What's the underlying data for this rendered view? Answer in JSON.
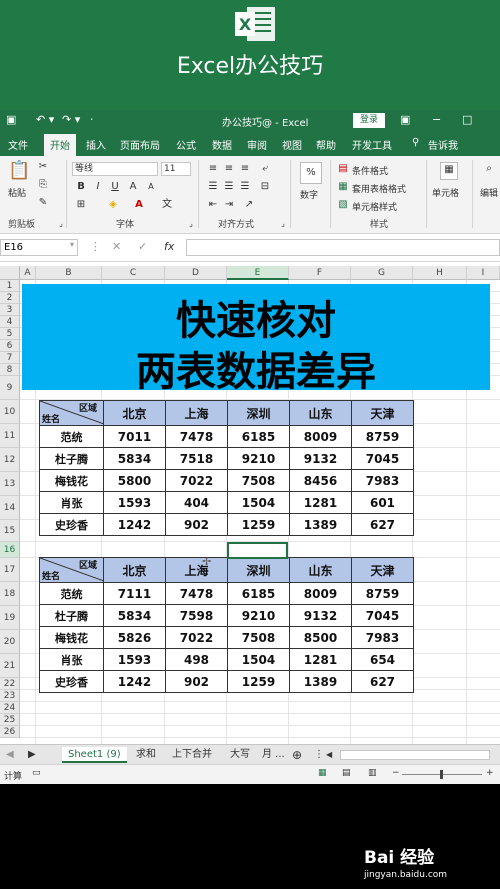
{
  "banner": {
    "title": "Excel办公技巧",
    "logo_letter": "X"
  },
  "titlebar": {
    "document": "办公技巧@ - Excel",
    "login": "登录"
  },
  "ribbon_tabs": [
    "文件",
    "开始",
    "插入",
    "页面布局",
    "公式",
    "数据",
    "审阅",
    "视图",
    "帮助",
    "开发工具",
    "告诉我"
  ],
  "ribbon": {
    "paste": "粘贴",
    "font_name": "等线",
    "font_size": "11",
    "bold": "B",
    "italic": "I",
    "underline": "U",
    "number": "数字",
    "percent": "%",
    "cond_format": "条件格式",
    "table_format": "套用表格格式",
    "cell_style": "单元格样式",
    "cells": "单元格",
    "edit": "编辑",
    "groups": [
      "剪贴板",
      "字体",
      "对齐方式",
      "样式"
    ]
  },
  "formula_bar": {
    "name_box": "E16",
    "fx": "fx"
  },
  "columns": [
    "A",
    "B",
    "C",
    "D",
    "E",
    "F",
    "G",
    "H",
    "I"
  ],
  "rows": [
    "1",
    "2",
    "3",
    "4",
    "5",
    "6",
    "7",
    "8",
    "9",
    "10",
    "11",
    "12",
    "13",
    "14",
    "15",
    "16",
    "17",
    "18",
    "19",
    "20",
    "21",
    "22",
    "23",
    "24",
    "25",
    "26"
  ],
  "hero": {
    "line1": "快速核对",
    "line2": "两表数据差异"
  },
  "table_corner": {
    "top": "区域",
    "bottom": "姓名"
  },
  "table_headers": [
    "北京",
    "上海",
    "深圳",
    "山东",
    "天津"
  ],
  "table1": [
    {
      "name": "范统",
      "values": [
        "7011",
        "7478",
        "6185",
        "8009",
        "8759"
      ]
    },
    {
      "name": "杜子腾",
      "values": [
        "5834",
        "7518",
        "9210",
        "9132",
        "7045"
      ]
    },
    {
      "name": "梅钱花",
      "values": [
        "5800",
        "7022",
        "7508",
        "8456",
        "7983"
      ]
    },
    {
      "name": "肖张",
      "values": [
        "1593",
        "404",
        "1504",
        "1281",
        "601"
      ]
    },
    {
      "name": "史珍香",
      "values": [
        "1242",
        "902",
        "1259",
        "1389",
        "627"
      ]
    }
  ],
  "table2": [
    {
      "name": "范统",
      "values": [
        "7111",
        "7478",
        "6185",
        "8009",
        "8759"
      ]
    },
    {
      "name": "杜子腾",
      "values": [
        "5834",
        "7598",
        "9210",
        "9132",
        "7045"
      ]
    },
    {
      "name": "梅钱花",
      "values": [
        "5826",
        "7022",
        "7508",
        "8500",
        "7983"
      ]
    },
    {
      "name": "肖张",
      "values": [
        "1593",
        "498",
        "1504",
        "1281",
        "654"
      ]
    },
    {
      "name": "史珍香",
      "values": [
        "1242",
        "902",
        "1259",
        "1389",
        "627"
      ]
    }
  ],
  "sheet_tabs": [
    "Sheet1 (9)",
    "求和",
    "上下合并",
    "大写",
    "月 ..."
  ],
  "status": {
    "left": "计算",
    "zoom_minus": "−",
    "zoom_plus": "+"
  },
  "watermark": {
    "brand": "Bai 经验",
    "site": "jingyan.baidu.com"
  },
  "colors": {
    "excel_green": "#217346",
    "hero_blue": "#00b0f0",
    "header_blue": "#b4c6e7"
  }
}
